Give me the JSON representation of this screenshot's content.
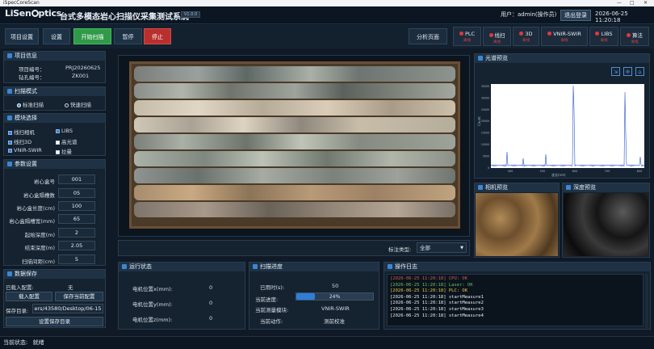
{
  "window_title": "iSpecCoreScan",
  "logo": {
    "text_a": "LiSen",
    "text_b": "ptics"
  },
  "app_title": "台式多模态岩心扫描仪采集测试系统",
  "version": "V1.0.0",
  "user_label": "用户：admin(操作员)",
  "logout_label": "退出登录",
  "clock": "2026-06-25 11:20:18",
  "toolbar": {
    "project_settings": "项目设置",
    "settings": "设置",
    "start_scan": "开始扫描",
    "pause": "暂停",
    "stop": "停止",
    "analysis_page": "分析页面",
    "colors": {
      "start": "#2f9a48",
      "stop": "#b8302e",
      "status_off": "#e0393a"
    }
  },
  "devices": [
    {
      "name": "PLC",
      "status": "离线"
    },
    {
      "name": "线扫",
      "status": "离线"
    },
    {
      "name": "3D",
      "status": "离线"
    },
    {
      "name": "VNIR-SWIR",
      "status": "离线"
    },
    {
      "name": "LIBS",
      "status": "离线"
    },
    {
      "name": "算法",
      "status": "离线"
    }
  ],
  "project_info": {
    "title": "项目信息",
    "project_no_label": "项目编号：",
    "project_no": "PRJ20260625",
    "hole_no_label": "钻孔编号：",
    "hole_no": "ZK001"
  },
  "scan_mode": {
    "title": "扫描模式",
    "options": [
      "标准扫描",
      "快速扫描"
    ],
    "selected": "标准扫描"
  },
  "modules": {
    "title": "模块选择",
    "items": [
      {
        "label": "线扫相机",
        "checked": true
      },
      {
        "label": "LIBS",
        "checked": true
      },
      {
        "label": "线扫3D",
        "checked": true
      },
      {
        "label": "高光谱",
        "checked": false
      },
      {
        "label": "VNIR-SWIR",
        "checked": true
      },
      {
        "label": "拉曼",
        "checked": false
      }
    ]
  },
  "params": {
    "title": "参数设置",
    "fields": [
      {
        "label": "岩心盒号",
        "value": "001"
      },
      {
        "label": "岩心盒隔槽数",
        "value": "05"
      },
      {
        "label": "岩心盒长度(cm)",
        "value": "100"
      },
      {
        "label": "岩心盒隔槽宽(mm)",
        "value": "65"
      },
      {
        "label": "起始深度(m)",
        "value": "2"
      },
      {
        "label": "结束深度(m)",
        "value": "2.05"
      },
      {
        "label": "扫描间距(cm)",
        "value": "5"
      }
    ]
  },
  "data_save": {
    "title": "数据保存",
    "loaded_label": "已载入配置:",
    "loaded_value": "无",
    "load_btn": "载入配置",
    "save_cfg_btn": "保存当前配置",
    "dir_label": "保存目录:",
    "dir_value": "ers/43580/Desktop/06-15",
    "set_dir_btn": "设置保存目录"
  },
  "mark_type": {
    "label": "标注类型:",
    "value": "全部"
  },
  "spectrum": {
    "title": "光谱预览",
    "ylabel": "Count",
    "xlabel": "波长(nm)",
    "x_ticks": [
      "400",
      "500",
      "600",
      "700",
      "800"
    ],
    "y_ticks": [
      "0",
      "5000",
      "10000",
      "15000",
      "20000",
      "25000",
      "30000",
      "35000"
    ]
  },
  "camera_preview": {
    "title": "相机预览"
  },
  "depth_preview": {
    "title": "深度预览"
  },
  "run_status": {
    "title": "运行状态",
    "rows": [
      {
        "label": "电机位置x(mm):",
        "value": "0"
      },
      {
        "label": "电机位置y(mm):",
        "value": "0"
      },
      {
        "label": "电机位置z(mm):",
        "value": "0"
      }
    ]
  },
  "scan_progress": {
    "title": "扫描进度",
    "elapsed_label": "已用时(s):",
    "elapsed": "50",
    "progress_label": "当前进度:",
    "progress_text": "24%",
    "progress": 0.24,
    "module_label": "当前测量模块:",
    "module": "VNIR-SWIR",
    "action_label": "当前动作:",
    "action": "测前校准"
  },
  "oplog": {
    "title": "操作日志",
    "lines": [
      {
        "text": "[2026-06-25 11:20:18]  CPU: OK",
        "color": "#d25a55"
      },
      {
        "text": "[2026-06-25 11:20:18]  Laser: OK",
        "color": "#6fbf5e"
      },
      {
        "text": "[2026-06-25 11:20:18]  PLC: OK",
        "color": "#e7c34b"
      },
      {
        "text": "[2026-06-25 11:20:18]  startMeasure1",
        "color": "#e6edf5"
      },
      {
        "text": "[2026-06-25 11:20:18]  startMeasure2",
        "color": "#e6edf5"
      },
      {
        "text": "[2026-06-25 11:20:18]  startMeasure3",
        "color": "#e6edf5"
      },
      {
        "text": "[2026-06-25 11:20:18]  startMeasure4",
        "color": "#e6edf5"
      }
    ]
  },
  "status_bar": {
    "label": "当前状态:",
    "value": "就绪"
  }
}
